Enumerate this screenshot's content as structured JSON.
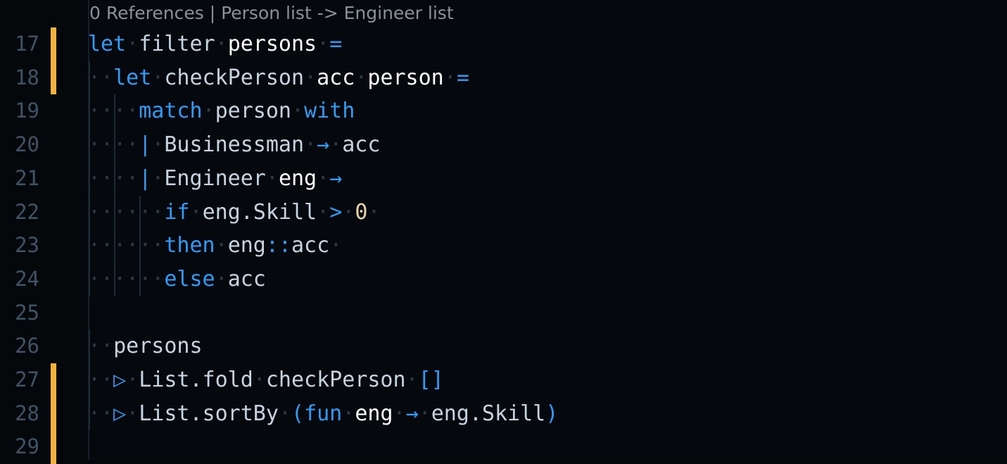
{
  "editor": {
    "language": "fsharp",
    "background": "#04080b",
    "content_background": "#05090d",
    "line_number_color": "#3f5366",
    "change_bar_color": "#f2b33d",
    "indent_guide_color": "#1d2b38",
    "whitespace_dot_color": "#2b3947",
    "keyword_color": "#2f9bf5",
    "identifier_color": "#c5d4e0",
    "parameter_color": "#ffffff",
    "operator_color": "#2f9bf5",
    "number_color": "#e8d3ad",
    "whitespace_dot": "·"
  },
  "codelens": {
    "references": "0 References",
    "separator": "|",
    "signature": "Person list -> Engineer list",
    "full_text": "0 References | Person list -> Engineer list"
  },
  "lines": [
    {
      "number": "17",
      "changed": true,
      "guides": [],
      "tokens": [
        {
          "t": "let",
          "c": "kw"
        },
        {
          "t": "·",
          "c": "ws"
        },
        {
          "t": "filter",
          "c": "id"
        },
        {
          "t": "·",
          "c": "ws"
        },
        {
          "t": "persons",
          "c": "par"
        },
        {
          "t": "·",
          "c": "ws"
        },
        {
          "t": "=",
          "c": "op"
        }
      ]
    },
    {
      "number": "18",
      "changed": true,
      "guides": [
        0
      ],
      "tokens": [
        {
          "t": "··",
          "c": "ws"
        },
        {
          "t": "let",
          "c": "kw"
        },
        {
          "t": "·",
          "c": "ws"
        },
        {
          "t": "checkPerson",
          "c": "id"
        },
        {
          "t": "·",
          "c": "ws"
        },
        {
          "t": "acc",
          "c": "par"
        },
        {
          "t": "·",
          "c": "ws"
        },
        {
          "t": "person",
          "c": "par"
        },
        {
          "t": "·",
          "c": "ws"
        },
        {
          "t": "=",
          "c": "op"
        }
      ]
    },
    {
      "number": "19",
      "changed": false,
      "guides": [
        0,
        2
      ],
      "tokens": [
        {
          "t": "··",
          "c": "ws"
        },
        {
          "t": "··",
          "c": "ws"
        },
        {
          "t": "match",
          "c": "kw"
        },
        {
          "t": "·",
          "c": "ws"
        },
        {
          "t": "person",
          "c": "id"
        },
        {
          "t": "·",
          "c": "ws"
        },
        {
          "t": "with",
          "c": "kw"
        }
      ]
    },
    {
      "number": "20",
      "changed": false,
      "guides": [
        0,
        2
      ],
      "tokens": [
        {
          "t": "··",
          "c": "ws"
        },
        {
          "t": "··",
          "c": "ws"
        },
        {
          "t": "|",
          "c": "op"
        },
        {
          "t": "·",
          "c": "ws"
        },
        {
          "t": "Businessman",
          "c": "id"
        },
        {
          "t": "·",
          "c": "ws"
        },
        {
          "t": "→",
          "c": "op"
        },
        {
          "t": "·",
          "c": "ws"
        },
        {
          "t": "acc",
          "c": "id"
        }
      ]
    },
    {
      "number": "21",
      "changed": false,
      "guides": [
        0,
        2
      ],
      "tokens": [
        {
          "t": "··",
          "c": "ws"
        },
        {
          "t": "··",
          "c": "ws"
        },
        {
          "t": "|",
          "c": "op"
        },
        {
          "t": "·",
          "c": "ws"
        },
        {
          "t": "Engineer",
          "c": "id"
        },
        {
          "t": "·",
          "c": "ws"
        },
        {
          "t": "eng",
          "c": "par"
        },
        {
          "t": "·",
          "c": "ws"
        },
        {
          "t": "→",
          "c": "op"
        }
      ]
    },
    {
      "number": "22",
      "changed": false,
      "guides": [
        0,
        2,
        4
      ],
      "tokens": [
        {
          "t": "··",
          "c": "ws"
        },
        {
          "t": "··",
          "c": "ws"
        },
        {
          "t": "··",
          "c": "ws"
        },
        {
          "t": "if",
          "c": "kw"
        },
        {
          "t": "·",
          "c": "ws"
        },
        {
          "t": "eng.Skill",
          "c": "id"
        },
        {
          "t": "·",
          "c": "ws"
        },
        {
          "t": ">",
          "c": "op"
        },
        {
          "t": "·",
          "c": "ws"
        },
        {
          "t": "0",
          "c": "num"
        },
        {
          "t": "·",
          "c": "ws"
        }
      ]
    },
    {
      "number": "23",
      "changed": false,
      "guides": [
        0,
        2,
        4
      ],
      "tokens": [
        {
          "t": "··",
          "c": "ws"
        },
        {
          "t": "··",
          "c": "ws"
        },
        {
          "t": "··",
          "c": "ws"
        },
        {
          "t": "then",
          "c": "kw"
        },
        {
          "t": "·",
          "c": "ws"
        },
        {
          "t": "eng",
          "c": "id"
        },
        {
          "t": "::",
          "c": "op"
        },
        {
          "t": "acc",
          "c": "id"
        },
        {
          "t": "·",
          "c": "ws"
        }
      ]
    },
    {
      "number": "24",
      "changed": false,
      "guides": [
        0,
        2,
        4
      ],
      "tokens": [
        {
          "t": "··",
          "c": "ws"
        },
        {
          "t": "··",
          "c": "ws"
        },
        {
          "t": "··",
          "c": "ws"
        },
        {
          "t": "else",
          "c": "kw"
        },
        {
          "t": "·",
          "c": "ws"
        },
        {
          "t": "acc",
          "c": "id"
        }
      ]
    },
    {
      "number": "25",
      "changed": false,
      "guides": [],
      "tokens": []
    },
    {
      "number": "26",
      "changed": false,
      "guides": [
        0
      ],
      "tokens": [
        {
          "t": "··",
          "c": "ws"
        },
        {
          "t": "persons",
          "c": "id"
        }
      ]
    },
    {
      "number": "27",
      "changed": true,
      "guides": [
        0
      ],
      "tokens": [
        {
          "t": "··",
          "c": "ws"
        },
        {
          "t": "▷",
          "c": "op"
        },
        {
          "t": "·",
          "c": "ws"
        },
        {
          "t": "List.fold",
          "c": "id"
        },
        {
          "t": "·",
          "c": "ws"
        },
        {
          "t": "checkPerson",
          "c": "id"
        },
        {
          "t": "·",
          "c": "ws"
        },
        {
          "t": "[]",
          "c": "op"
        }
      ]
    },
    {
      "number": "28",
      "changed": true,
      "guides": [
        0
      ],
      "tokens": [
        {
          "t": "··",
          "c": "ws"
        },
        {
          "t": "▷",
          "c": "op"
        },
        {
          "t": "·",
          "c": "ws"
        },
        {
          "t": "List.sortBy",
          "c": "id"
        },
        {
          "t": "·",
          "c": "ws"
        },
        {
          "t": "(",
          "c": "op"
        },
        {
          "t": "fun",
          "c": "kw"
        },
        {
          "t": "·",
          "c": "ws"
        },
        {
          "t": "eng",
          "c": "par"
        },
        {
          "t": "·",
          "c": "ws"
        },
        {
          "t": "→",
          "c": "op"
        },
        {
          "t": "·",
          "c": "ws"
        },
        {
          "t": "eng.Skill",
          "c": "id"
        },
        {
          "t": ")",
          "c": "op"
        }
      ]
    },
    {
      "number": "29",
      "changed": true,
      "guides": [],
      "tokens": []
    }
  ],
  "source_text": {
    "17": "let filter persons =",
    "18": "  let checkPerson acc person =",
    "19": "    match person with",
    "20": "    | Businessman -> acc",
    "21": "    | Engineer eng ->",
    "22": "      if eng.Skill > 0 ",
    "23": "      then eng::acc ",
    "24": "      else acc",
    "25": "",
    "26": "  persons",
    "27": "  |> List.fold checkPerson []",
    "28": "  |> List.sortBy (fun eng -> eng.Skill)",
    "29": ""
  }
}
